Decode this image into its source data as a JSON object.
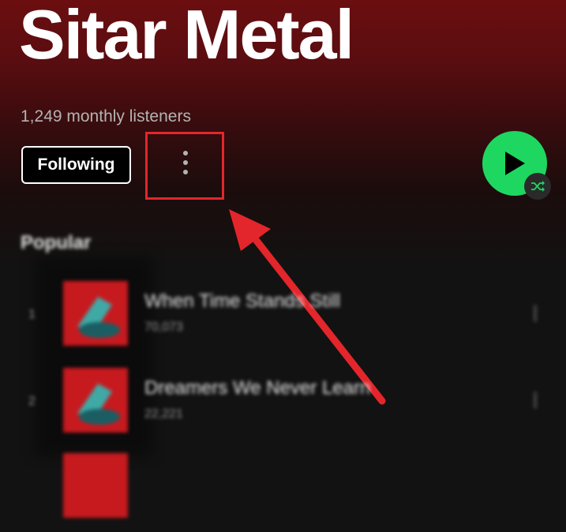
{
  "artist": {
    "name": "Sitar Metal",
    "monthly_listeners": "1,249 monthly listeners"
  },
  "actions": {
    "follow_label": "Following",
    "more_icon": "more-vertical-icon",
    "play_icon": "play-icon",
    "shuffle_icon": "shuffle-icon"
  },
  "popular": {
    "heading": "Popular",
    "tracks": [
      {
        "rank": "1",
        "title": "When Time Stands Still",
        "plays": "70,073"
      },
      {
        "rank": "2",
        "title": "Dreamers We Never Learn",
        "plays": "22,221"
      }
    ]
  },
  "colors": {
    "accent_green": "#1ed760",
    "annotation_red": "#e3262b",
    "header_red": "#6b0e10",
    "background": "#121212"
  }
}
